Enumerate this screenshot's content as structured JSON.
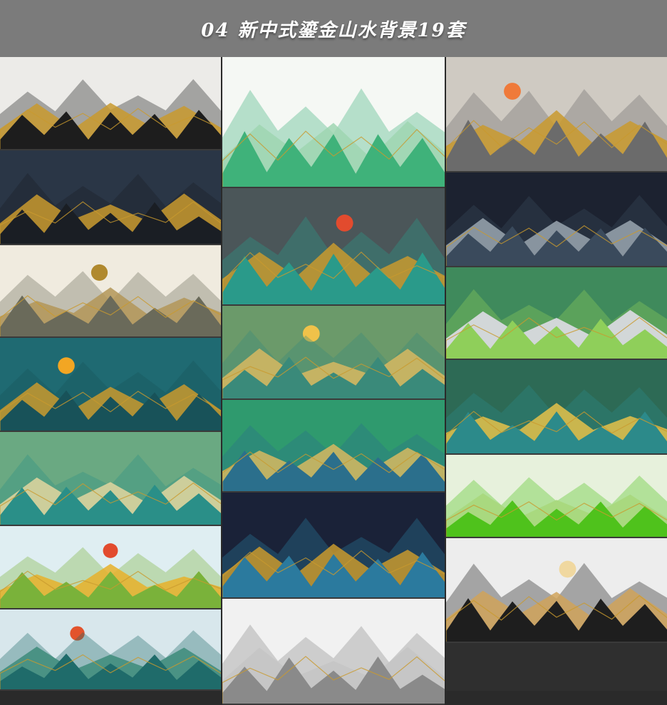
{
  "header": {
    "title": "04 新中式鎏金山水背景19套"
  },
  "colors": {
    "header_bg": "#7b7b7b",
    "page_bg": "#2a2a2a",
    "gold": "#c99a2e"
  },
  "tiles": [
    {
      "id": "a1",
      "theme": "grey-gold-mountains-blossom",
      "bg": "#ecebe8",
      "hill": "#1d1d1d",
      "accent": "#c99a2e",
      "sun": "none"
    },
    {
      "id": "a2",
      "theme": "navy-gold-mountains-cranes",
      "bg": "#2a3646",
      "hill": "#1a1e24",
      "accent": "#c99a2e",
      "sun": "none"
    },
    {
      "id": "a3",
      "theme": "cream-round-window-swallows",
      "bg": "#f0ebdf",
      "hill": "#6a6a5a",
      "accent": "#b39658",
      "sun": "#b0892e"
    },
    {
      "id": "a4",
      "theme": "teal-magnolia-gold",
      "bg": "#1f6a72",
      "hill": "#185259",
      "accent": "#c99a2e",
      "sun": "#f2a623"
    },
    {
      "id": "a5",
      "theme": "green-teal-layered-hills",
      "bg": "#6aa982",
      "hill": "#2a8f88",
      "accent": "#e3d6a0",
      "sun": "none"
    },
    {
      "id": "a6",
      "theme": "pale-blue-layered-paper-red-sun",
      "bg": "#dfeef2",
      "hill": "#7ab23a",
      "accent": "#e8b02a",
      "sun": "#e24b2e"
    },
    {
      "id": "a7",
      "theme": "misty-blue-pavilion-red-sun",
      "bg": "#d8e7ec",
      "hill": "#1f6b6a",
      "accent": "#3c8b7a",
      "sun": "#e2532c"
    },
    {
      "id": "b1",
      "theme": "white-green-watercolor-birds",
      "bg": "#f5f8f4",
      "hill": "#3fb27a",
      "accent": "#9fd6b2",
      "sun": "none"
    },
    {
      "id": "b2",
      "theme": "grey-red-teal-floating-islands",
      "bg": "#4b5659",
      "hill": "#2a9a8a",
      "accent": "#c99a2e",
      "sun": "#e24b2e"
    },
    {
      "id": "b3",
      "theme": "olive-green-gold-pines",
      "bg": "#6b9a6a",
      "hill": "#3a8a7a",
      "accent": "#d8b860",
      "sun": "#f0c24a"
    },
    {
      "id": "b4",
      "theme": "green-gold-peak-clouds",
      "bg": "#2f9a6e",
      "hill": "#2b6f8c",
      "accent": "#d8b860",
      "sun": "none"
    },
    {
      "id": "b5",
      "theme": "navy-stage-teal-waves",
      "bg": "#1a2238",
      "hill": "#2b7a9e",
      "accent": "#c99a2e",
      "sun": "none"
    },
    {
      "id": "b6",
      "theme": "white-ink-wash-mountains",
      "bg": "#f1f1f1",
      "hill": "#8a8a8a",
      "accent": "#c4c4c4",
      "sun": "none"
    },
    {
      "id": "c1",
      "theme": "misty-gold-floating-rocks",
      "bg": "#cfcac2",
      "hill": "#6b6b6b",
      "accent": "#c99a2e",
      "sun": "#ef7a3a"
    },
    {
      "id": "c2",
      "theme": "dark-navy-silver-waves",
      "bg": "#1c2230",
      "hill": "#3a4a5c",
      "accent": "#9aa6b0",
      "sun": "none"
    },
    {
      "id": "c3",
      "theme": "green-snow-peaks-lotus",
      "bg": "#3f8a5c",
      "hill": "#8fcf5a",
      "accent": "#e8e0ef",
      "sun": "none"
    },
    {
      "id": "c4",
      "theme": "deep-green-teal-island-crane",
      "bg": "#2d6a55",
      "hill": "#2c8a8a",
      "accent": "#e6c24a",
      "sun": "none"
    },
    {
      "id": "c5",
      "theme": "light-green-bright-peaks-bamboo",
      "bg": "#e7f1dc",
      "hill": "#4fc21c",
      "accent": "#a7d77a",
      "sun": "none"
    },
    {
      "id": "c6",
      "theme": "white-wall-moon-gate",
      "bg": "#ededed",
      "hill": "#1e1e1e",
      "accent": "#d0a35a",
      "sun": "#f0d8a0"
    }
  ]
}
